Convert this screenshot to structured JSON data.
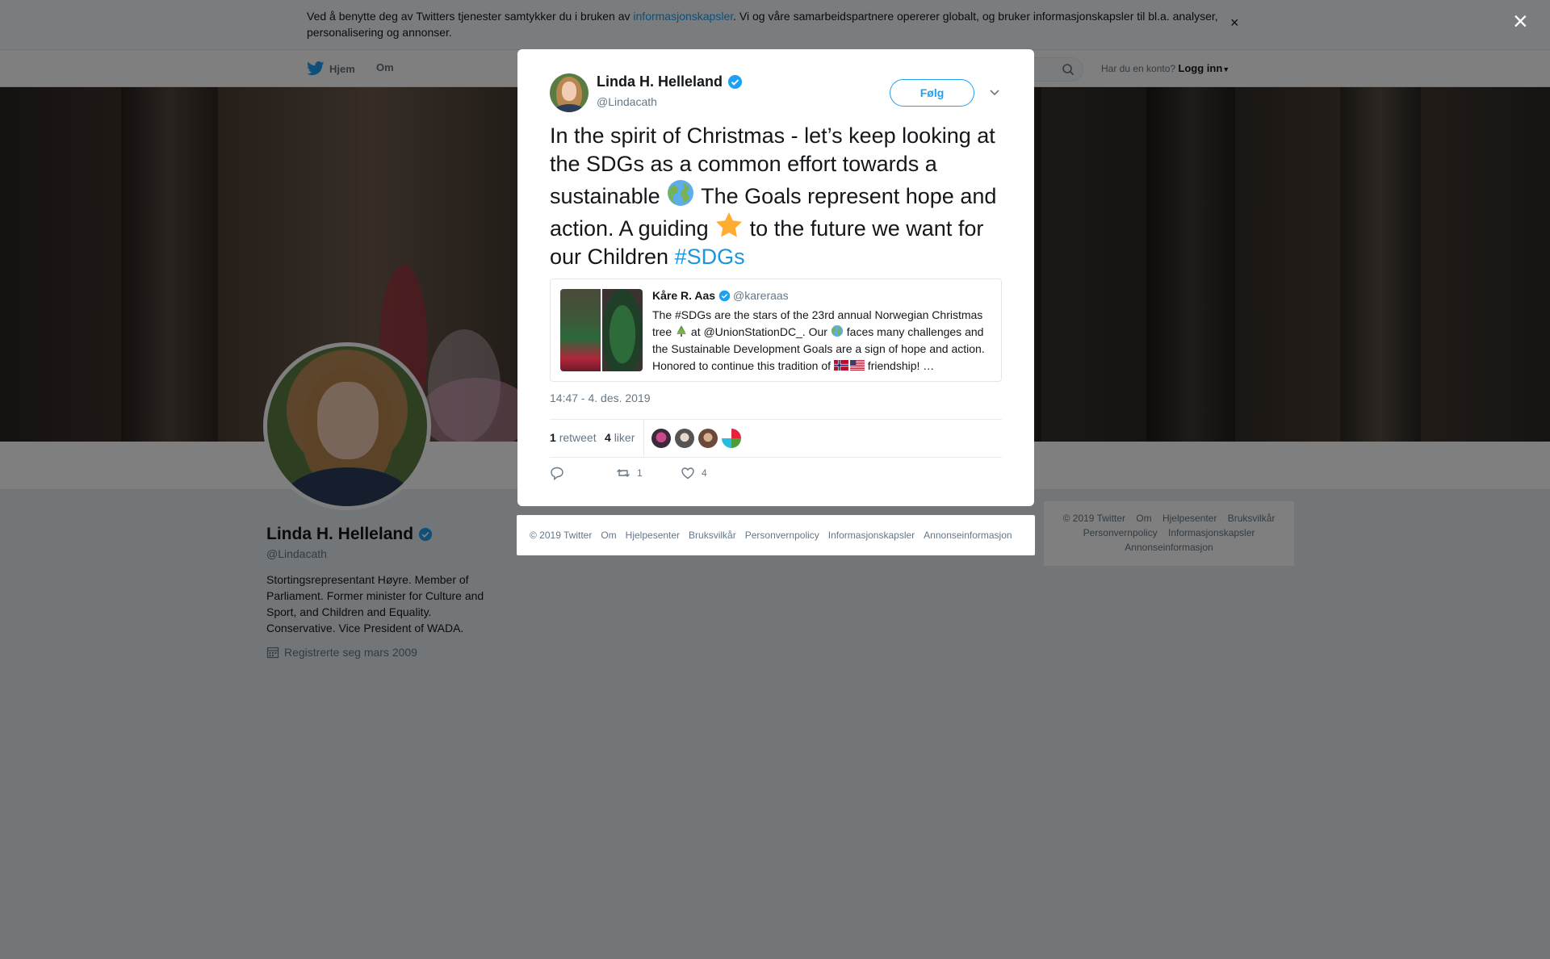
{
  "cookie_bar": {
    "text_before": "Ved å benytte deg av Twitters tjenester samtykker du i bruken av ",
    "link": "informasjonskapsler",
    "text_after": ". Vi og våre samarbeidspartnere opererer globalt, og bruker informasjonskapsler til bl.a. analyser, personalisering og annonser.",
    "close": "×"
  },
  "topnav": {
    "home": "Hjem",
    "about": "Om",
    "account_prompt": "Har du en konto?",
    "login": "Logg inn"
  },
  "profile": {
    "name": "Linda H. Helleland",
    "handle": "@Lindacath",
    "bio": "Stortingsrepresentant Høyre. Member of Parliament. Former minister for Culture and Sport, and Children and Equality. Conservative. Vice President of WADA.",
    "joined": "Registrerte seg mars 2009"
  },
  "right_footer": {
    "line1": [
      "© 2019 Twitter",
      "Om",
      "Hjelpesenter",
      "Bruksvilkår"
    ],
    "line2": [
      "Personvernpolicy",
      "Informasjonskapsler"
    ],
    "line3": [
      "Annonseinformasjon"
    ]
  },
  "overlay": {
    "close": "×"
  },
  "tweet": {
    "author_name": "Linda H. Helleland",
    "author_handle": "@Lindacath",
    "follow": "Følg",
    "text_1": "In the spirit of Christmas - let’s keep looking at the SDGs as a common effort towards a sustainable ",
    "text_2": " The Goals represent hope and action. A guiding ",
    "text_3": " to the future we want for our Children ",
    "hashtag": "#SDGs",
    "time": "14:47 - 4. des. 2019",
    "retweet_count": "1",
    "retweet_label": "retweet",
    "like_count": "4",
    "like_label": "liker",
    "reply_count": "",
    "action_retweets": "1",
    "action_likes": "4"
  },
  "quote": {
    "name": "Kåre R. Aas",
    "handle": "@kareraas",
    "text_1": "The #SDGs are the stars of the 23rd annual Norwegian Christmas tree ",
    "text_2": " at @UnionStationDC_. Our ",
    "text_3": " faces many challenges and the Sustainable Development Goals are a sign of hope and action. Honored to continue this tradition of ",
    "text_4": " friendship! …"
  },
  "modal_footer": [
    "© 2019 Twitter",
    "Om",
    "Hjelpesenter",
    "Bruksvilkår",
    "Personvernpolicy",
    "Informasjonskapsler",
    "Annonseinformasjon"
  ],
  "icons": {
    "verified": "verified-badge-icon",
    "globe": "earth-globe-emoji",
    "star": "star-emoji",
    "tree": "christmas-tree-emoji",
    "flags": [
      "norway-flag-emoji",
      "usa-flag-emoji"
    ]
  },
  "colors": {
    "twitter_blue": "#1da1f2",
    "hashtag": "#1b95e0",
    "text": "#14171a",
    "muted": "#657786"
  }
}
